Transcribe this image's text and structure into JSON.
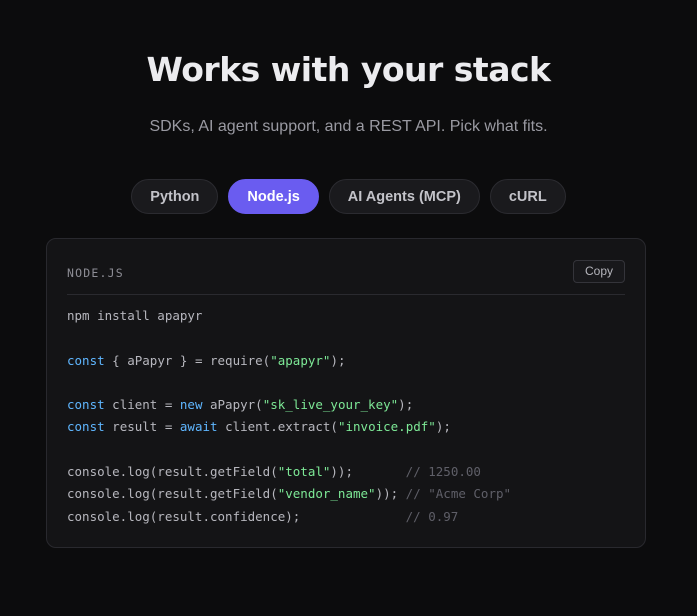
{
  "hero": {
    "title": "Works with your stack",
    "subtitle": "SDKs, AI agent support, and a REST API. Pick what fits."
  },
  "tabs": [
    {
      "label": "Python",
      "active": false
    },
    {
      "label": "Node.js",
      "active": true
    },
    {
      "label": "AI Agents (MCP)",
      "active": false
    },
    {
      "label": "cURL",
      "active": false
    }
  ],
  "code_panel": {
    "language_label": "NODE.JS",
    "copy_label": "Copy",
    "lines": [
      [
        {
          "t": "npm install apapyr",
          "c": ""
        }
      ],
      [],
      [
        {
          "t": "const",
          "c": "kw"
        },
        {
          "t": " { aPapyr } = require(",
          "c": ""
        },
        {
          "t": "\"apapyr\"",
          "c": "str"
        },
        {
          "t": ");",
          "c": ""
        }
      ],
      [],
      [
        {
          "t": "const",
          "c": "kw"
        },
        {
          "t": " client = ",
          "c": ""
        },
        {
          "t": "new",
          "c": "kw"
        },
        {
          "t": " aPapyr(",
          "c": ""
        },
        {
          "t": "\"sk_live_your_key\"",
          "c": "str"
        },
        {
          "t": ");",
          "c": ""
        }
      ],
      [
        {
          "t": "const",
          "c": "kw"
        },
        {
          "t": " result = ",
          "c": ""
        },
        {
          "t": "await",
          "c": "kw"
        },
        {
          "t": " client.extract(",
          "c": ""
        },
        {
          "t": "\"invoice.pdf\"",
          "c": "str"
        },
        {
          "t": ");",
          "c": ""
        }
      ],
      [],
      [
        {
          "t": "console.log(result.getField(",
          "c": ""
        },
        {
          "t": "\"total\"",
          "c": "str"
        },
        {
          "t": "));       ",
          "c": ""
        },
        {
          "t": "// 1250.00",
          "c": "cmt"
        }
      ],
      [
        {
          "t": "console.log(result.getField(",
          "c": ""
        },
        {
          "t": "\"vendor_name\"",
          "c": "str"
        },
        {
          "t": ")); ",
          "c": ""
        },
        {
          "t": "// \"Acme Corp\"",
          "c": "cmt"
        }
      ],
      [
        {
          "t": "console.log(result.confidence);              ",
          "c": ""
        },
        {
          "t": "// 0.97",
          "c": "cmt"
        }
      ]
    ]
  },
  "colors": {
    "background": "#0c0c0d",
    "accent": "#6a5cf0",
    "keyword": "#5fb6ff",
    "string": "#7de896",
    "comment": "#5f5f68"
  }
}
